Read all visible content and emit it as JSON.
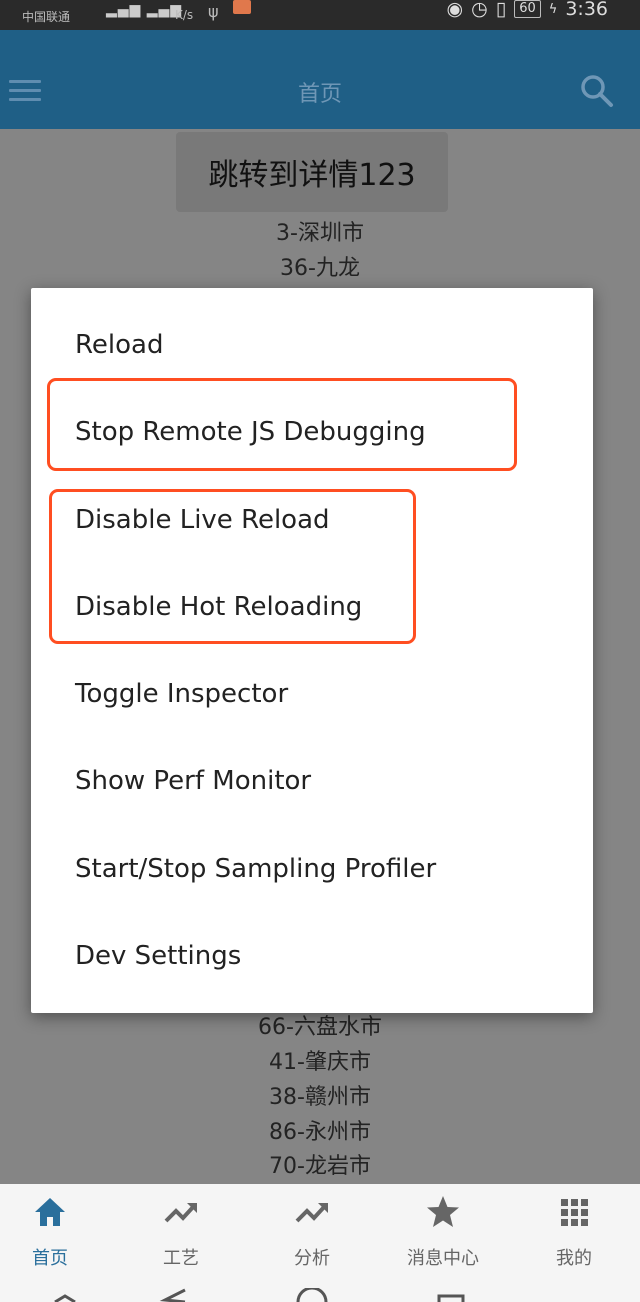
{
  "status_bar": {
    "carrier": "中国联通",
    "net_speed": "K/s",
    "battery": "60",
    "time": "3:36",
    "icons": [
      "eye-icon",
      "alarm-icon",
      "vibrate-icon",
      "battery-icon",
      "charging-icon"
    ]
  },
  "app_bar": {
    "title": "首页",
    "menu_icon": "hamburger-icon",
    "search_icon": "search-icon"
  },
  "content": {
    "jump_button": "跳转到详情123",
    "cities_top": [
      "3-深圳市",
      "36-九龙"
    ],
    "cities_bottom": [
      "66-六盘水市",
      "41-肇庆市",
      "38-赣州市",
      "86-永州市",
      "70-龙岩市"
    ]
  },
  "dev_menu": {
    "items": [
      "Reload",
      "Stop Remote JS Debugging",
      "Disable Live Reload",
      "Disable Hot Reloading",
      "Toggle Inspector",
      "Show Perf Monitor",
      "Start/Stop Sampling Profiler",
      "Dev Settings"
    ],
    "highlight_color": "#ff4e21"
  },
  "tab_bar": {
    "active_color": "#2a6f9c",
    "tabs": [
      {
        "label": "首页",
        "icon": "home-icon",
        "active": true
      },
      {
        "label": "工艺",
        "icon": "trend-icon",
        "active": false
      },
      {
        "label": "分析",
        "icon": "trend-icon",
        "active": false
      },
      {
        "label": "消息中心",
        "icon": "star-icon",
        "active": false
      },
      {
        "label": "我的",
        "icon": "grid-icon",
        "active": false
      }
    ]
  }
}
